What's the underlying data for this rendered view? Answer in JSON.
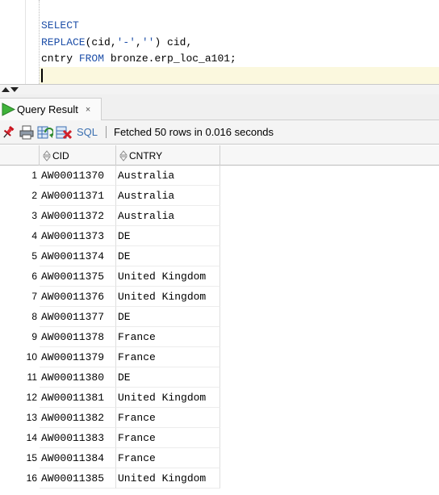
{
  "editor": {
    "lines": [
      [
        {
          "t": "SELECT",
          "c": "kw"
        }
      ],
      [
        {
          "t": "REPLACE",
          "c": "kw"
        },
        {
          "t": "(cid,",
          "c": ""
        },
        {
          "t": "'-'",
          "c": "str"
        },
        {
          "t": ",",
          "c": ""
        },
        {
          "t": "''",
          "c": "str"
        },
        {
          "t": ") cid,",
          "c": ""
        }
      ],
      [
        {
          "t": "cntry ",
          "c": ""
        },
        {
          "t": "FROM",
          "c": "kw"
        },
        {
          "t": " bronze.erp_loc_a101;",
          "c": ""
        }
      ]
    ]
  },
  "result_tab": {
    "label": "Query Result",
    "close_glyph": "×"
  },
  "toolbar": {
    "sql_label": "SQL",
    "status": "Fetched 50 rows in 0.016 seconds",
    "icons": [
      "pin-icon",
      "print-icon",
      "refresh-icon",
      "cancel-query-icon"
    ]
  },
  "grid": {
    "columns": [
      {
        "label": "CID"
      },
      {
        "label": "CNTRY"
      }
    ],
    "rows": [
      {
        "n": "1",
        "cid": "AW00011370",
        "cntry": "Australia"
      },
      {
        "n": "2",
        "cid": "AW00011371",
        "cntry": "Australia"
      },
      {
        "n": "3",
        "cid": "AW00011372",
        "cntry": "Australia"
      },
      {
        "n": "4",
        "cid": "AW00011373",
        "cntry": "DE"
      },
      {
        "n": "5",
        "cid": "AW00011374",
        "cntry": "DE"
      },
      {
        "n": "6",
        "cid": "AW00011375",
        "cntry": "United Kingdom"
      },
      {
        "n": "7",
        "cid": "AW00011376",
        "cntry": "United Kingdom"
      },
      {
        "n": "8",
        "cid": "AW00011377",
        "cntry": "DE"
      },
      {
        "n": "9",
        "cid": "AW00011378",
        "cntry": "France"
      },
      {
        "n": "10",
        "cid": "AW00011379",
        "cntry": "France"
      },
      {
        "n": "11",
        "cid": "AW00011380",
        "cntry": "DE"
      },
      {
        "n": "12",
        "cid": "AW00011381",
        "cntry": "United Kingdom"
      },
      {
        "n": "13",
        "cid": "AW00011382",
        "cntry": "France"
      },
      {
        "n": "14",
        "cid": "AW00011383",
        "cntry": "France"
      },
      {
        "n": "15",
        "cid": "AW00011384",
        "cntry": "France"
      },
      {
        "n": "16",
        "cid": "AW00011385",
        "cntry": "United Kingdom"
      }
    ]
  }
}
